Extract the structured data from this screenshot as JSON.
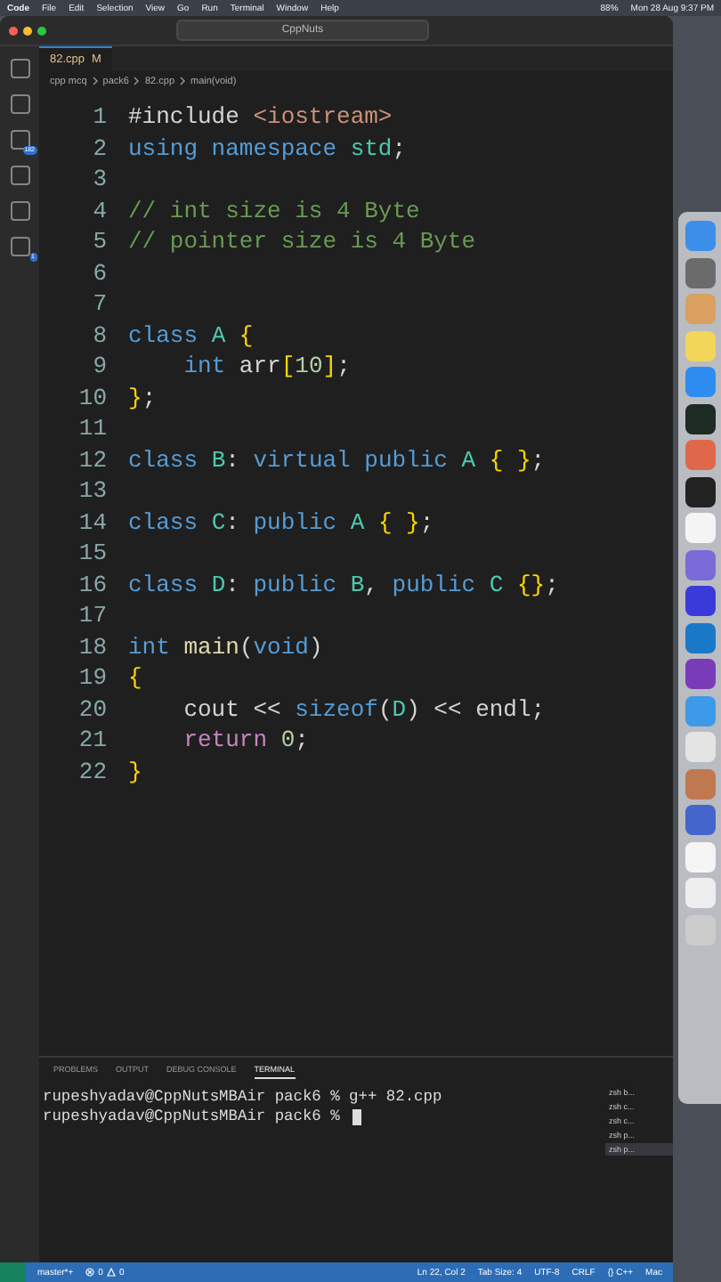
{
  "menu_bar": {
    "app": "Code",
    "items": [
      "File",
      "Edit",
      "Selection",
      "View",
      "Go",
      "Run",
      "Terminal",
      "Window",
      "Help"
    ],
    "battery": "88%",
    "clock": "Mon 28 Aug 9:37 PM"
  },
  "window": {
    "search": "CppNuts"
  },
  "activity_bar": {
    "badges": [
      "182",
      "1"
    ]
  },
  "tab": {
    "label": "82.cpp",
    "status": "M",
    "selected": true
  },
  "breadcrumb": [
    "cpp mcq",
    "pack6",
    "82.cpp",
    "main(void)"
  ],
  "editor": {
    "lines": [
      {
        "number": "1",
        "tokens": [
          {
            "kind": "plain",
            "text": "#include "
          },
          {
            "kind": "string",
            "text": "<iostream>"
          }
        ]
      },
      {
        "number": "2",
        "tokens": [
          {
            "kind": "keyword",
            "text": "using namespace "
          },
          {
            "kind": "type",
            "text": "std"
          },
          {
            "kind": "plain",
            "text": ";"
          }
        ]
      },
      {
        "number": "3"
      },
      {
        "number": "4",
        "tokens": [
          {
            "kind": "comment",
            "text": "// int size is 4 Byte"
          }
        ]
      },
      {
        "number": "5",
        "tokens": [
          {
            "kind": "comment",
            "text": "// pointer size is 4 Byte"
          }
        ]
      },
      {
        "number": "6"
      },
      {
        "number": "7"
      },
      {
        "number": "8",
        "tokens": [
          {
            "kind": "keyword",
            "text": "class "
          },
          {
            "kind": "type",
            "text": "A "
          },
          {
            "kind": "brace",
            "text": "{"
          }
        ]
      },
      {
        "number": "9",
        "tokens": [
          {
            "kind": "keyword",
            "text": "    int "
          },
          {
            "kind": "plain",
            "text": "arr"
          },
          {
            "kind": "brace",
            "text": "["
          },
          {
            "kind": "number",
            "text": "10"
          },
          {
            "kind": "brace",
            "text": "]"
          },
          {
            "kind": "plain",
            "text": ";"
          }
        ]
      },
      {
        "number": "10",
        "tokens": [
          {
            "kind": "brace",
            "text": "}"
          },
          {
            "kind": "plain",
            "text": ";"
          }
        ]
      },
      {
        "number": "11"
      },
      {
        "number": "12",
        "tokens": [
          {
            "kind": "keyword",
            "text": "class "
          },
          {
            "kind": "type",
            "text": "B"
          },
          {
            "kind": "plain",
            "text": ": "
          },
          {
            "kind": "keyword",
            "text": "virtual public "
          },
          {
            "kind": "type",
            "text": "A "
          },
          {
            "kind": "brace",
            "text": "{ }"
          },
          {
            "kind": "plain",
            "text": ";"
          }
        ]
      },
      {
        "number": "13"
      },
      {
        "number": "14",
        "tokens": [
          {
            "kind": "keyword",
            "text": "class "
          },
          {
            "kind": "type",
            "text": "C"
          },
          {
            "kind": "plain",
            "text": ": "
          },
          {
            "kind": "keyword",
            "text": "public "
          },
          {
            "kind": "type",
            "text": "A "
          },
          {
            "kind": "brace",
            "text": "{ }"
          },
          {
            "kind": "plain",
            "text": ";"
          }
        ]
      },
      {
        "number": "15"
      },
      {
        "number": "16",
        "tokens": [
          {
            "kind": "keyword",
            "text": "class "
          },
          {
            "kind": "type",
            "text": "D"
          },
          {
            "kind": "plain",
            "text": ": "
          },
          {
            "kind": "keyword",
            "text": "public "
          },
          {
            "kind": "type",
            "text": "B"
          },
          {
            "kind": "plain",
            "text": ", "
          },
          {
            "kind": "keyword",
            "text": "public "
          },
          {
            "kind": "type",
            "text": "C "
          },
          {
            "kind": "brace",
            "text": "{}"
          },
          {
            "kind": "plain",
            "text": ";"
          }
        ]
      },
      {
        "number": "17"
      },
      {
        "number": "18",
        "tokens": [
          {
            "kind": "keyword",
            "text": "int "
          },
          {
            "kind": "function",
            "text": "main"
          },
          {
            "kind": "plain",
            "text": "("
          },
          {
            "kind": "keyword",
            "text": "void"
          },
          {
            "kind": "plain",
            "text": ")"
          }
        ]
      },
      {
        "number": "19",
        "tokens": [
          {
            "kind": "brace",
            "text": "{"
          }
        ]
      },
      {
        "number": "20",
        "tokens": [
          {
            "kind": "plain",
            "text": "    cout << "
          },
          {
            "kind": "keyword",
            "text": "sizeof"
          },
          {
            "kind": "plain",
            "text": "("
          },
          {
            "kind": "type",
            "text": "D"
          },
          {
            "kind": "plain",
            "text": ") << endl;"
          }
        ]
      },
      {
        "number": "21",
        "tokens": [
          {
            "kind": "control",
            "text": "    return "
          },
          {
            "kind": "number",
            "text": "0"
          },
          {
            "kind": "plain",
            "text": ";"
          }
        ]
      },
      {
        "number": "22",
        "tokens": [
          {
            "kind": "brace",
            "text": "}"
          }
        ]
      }
    ]
  },
  "panel": {
    "tabs": [
      {
        "label": "PROBLEMS",
        "selected": false
      },
      {
        "label": "OUTPUT",
        "selected": false
      },
      {
        "label": "DEBUG CONSOLE",
        "selected": false
      },
      {
        "label": "TERMINAL",
        "selected": true
      }
    ],
    "terminal_lines": [
      "rupeshyadav@CppNutsMBAir pack6 % g++ 82.cpp",
      "rupeshyadav@CppNutsMBAir pack6 % "
    ],
    "terminals": [
      {
        "label": "zsh b...",
        "selected": false
      },
      {
        "label": "zsh c...",
        "selected": false
      },
      {
        "label": "zsh c...",
        "selected": false
      },
      {
        "label": "zsh p...",
        "selected": false
      },
      {
        "label": "zsh p...",
        "selected": true
      }
    ]
  },
  "status_bar": {
    "branch": "master*+",
    "errors": "0",
    "warnings": "0",
    "right": [
      "Ln 22, Col 2",
      "Tab Size: 4",
      "UTF-8",
      "CRLF",
      "{} C++",
      "Mac"
    ]
  }
}
